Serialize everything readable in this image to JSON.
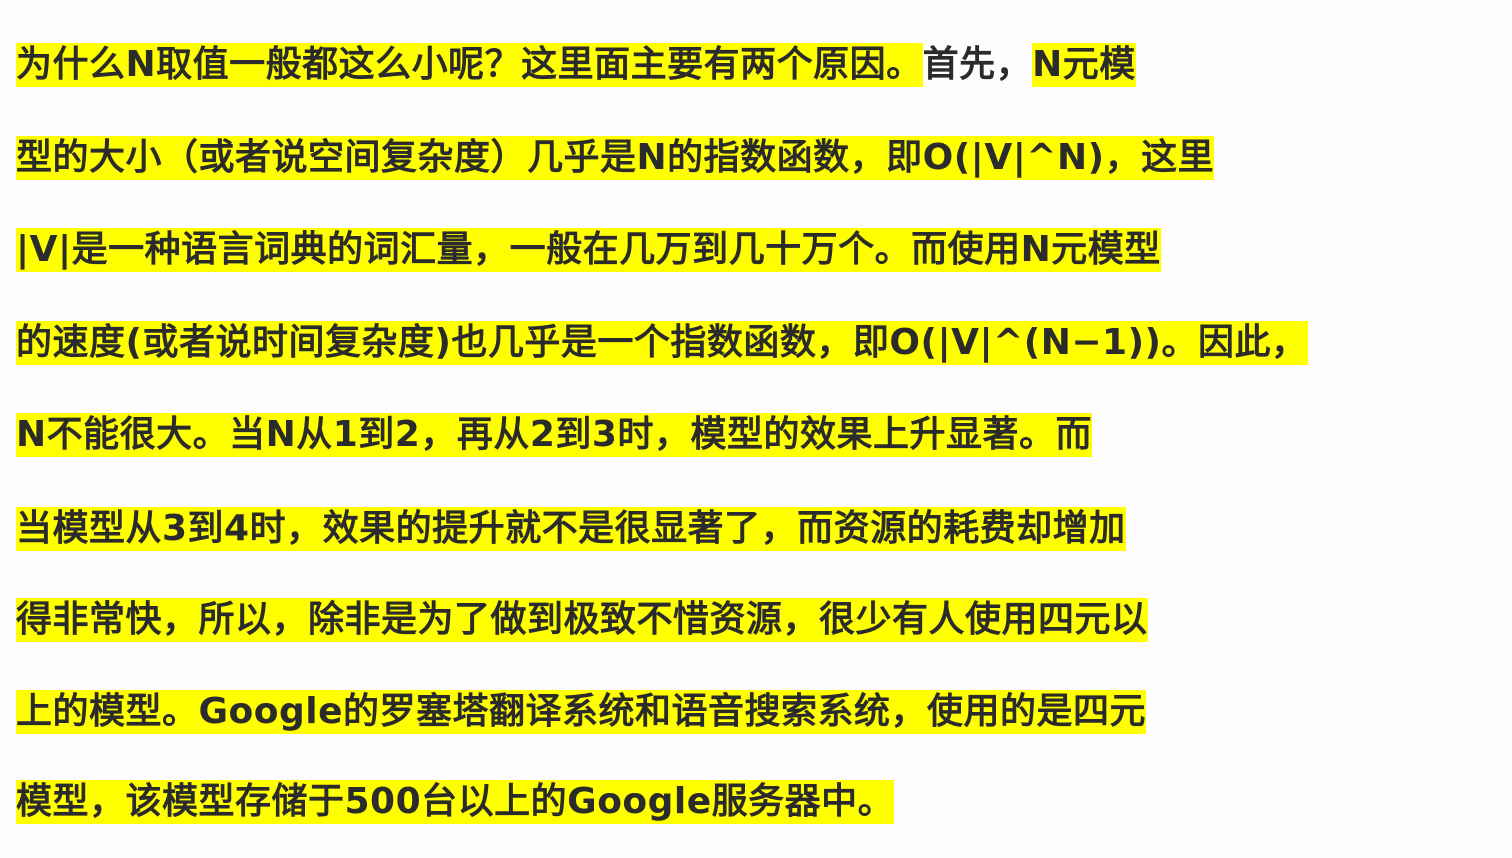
{
  "document": {
    "lines": [
      {
        "highlighted_start": "为什么N取值一般都这么小呢？这里面主要有两个原因。",
        "plain_middle": "首先，",
        "highlighted_end": "N元模"
      },
      {
        "text": "型的大小（或者说空间复杂度）几乎是N的指数函数，即O(|V|^N)，这里"
      },
      {
        "text": "|V|是一种语言词典的词汇量，一般在几万到几十万个。而使用N元模型"
      },
      {
        "text": "的速度(或者说时间复杂度)也几乎是一个指数函数，即O(|V|^(N−1))。因此，"
      },
      {
        "text": "N不能很大。当N从1到2，再从2到3时，模型的效果上升显著。而"
      },
      {
        "text": "当模型从3到4时，效果的提升就不是很显著了，而资源的耗费却增加"
      },
      {
        "text": "得非常快，所以，除非是为了做到极致不惜资源，很少有人使用四元以"
      },
      {
        "text": "上的模型。Google的罗塞塔翻译系统和语音搜索系统，使用的是四元"
      },
      {
        "text": "模型，该模型存储于500台以上的Google服务器中。"
      }
    ],
    "highlight_color": "#ffff00"
  }
}
